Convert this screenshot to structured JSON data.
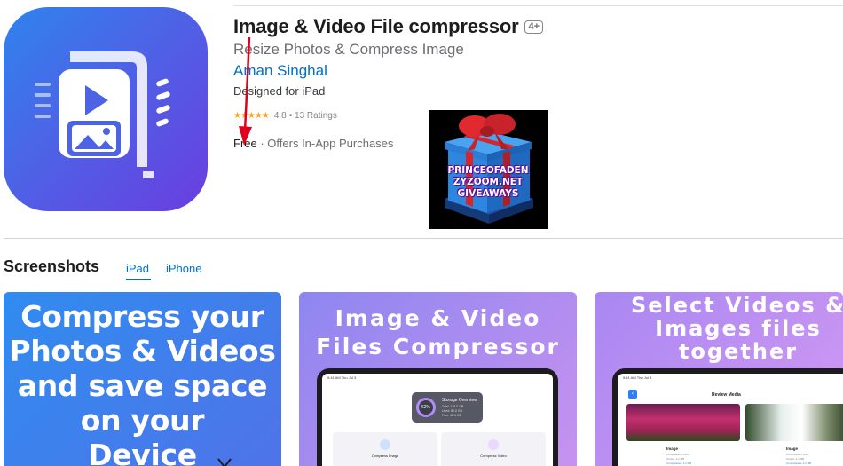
{
  "app": {
    "title": "Image & Video File compressor",
    "age_rating": "4+",
    "subtitle": "Resize Photos & Compress Image",
    "developer": "Aman Singhal",
    "designed_for": "Designed for iPad",
    "rating_value": "4.8",
    "rating_count": "• 13 Ratings",
    "stars": "★★★★★",
    "price": "Free",
    "price_note": "· Offers In-App Purchases",
    "icon": "photo-video-compress-icon"
  },
  "giveaway_image": {
    "lines": [
      "PRINCEOFADEN",
      "ZYZOOM.NET",
      "GIVEAWAYS"
    ]
  },
  "screenshots": {
    "heading": "Screenshots",
    "tabs": [
      {
        "label": "iPad",
        "selected": true
      },
      {
        "label": "iPhone",
        "selected": false
      }
    ],
    "cards": [
      {
        "lines": [
          "Compress your",
          "Photos & Videos",
          "and save space",
          "on your",
          "Device"
        ]
      },
      {
        "lines": [
          "Image & Video",
          "Files Compressor"
        ],
        "device": {
          "status": "9:41 AM   Thu Jul 3",
          "storage_title": "Storage Overview",
          "storage_percent": "62%",
          "storage_lines": [
            "Total: 128.0 GB",
            "Used: 80.0 GB",
            "Free: 48.0 GB"
          ],
          "compress_image": "Compress Image",
          "compress_video": "Compress Video"
        }
      },
      {
        "lines": [
          "Select Videos &",
          "Images files",
          "together"
        ],
        "device": {
          "status": "9:41 AM   Thu Jul 3",
          "title": "Review Media",
          "item1_label": "Image",
          "item2_label": "Image",
          "meta_lines": [
            "Compression: 80%",
            "Output: 4.1 MB"
          ],
          "link": "Compressed: 2.1 MB"
        }
      }
    ]
  },
  "colors": {
    "link_blue": "#0070c9",
    "star_orange": "#f5a623",
    "annotation_red": "#e0001b"
  }
}
